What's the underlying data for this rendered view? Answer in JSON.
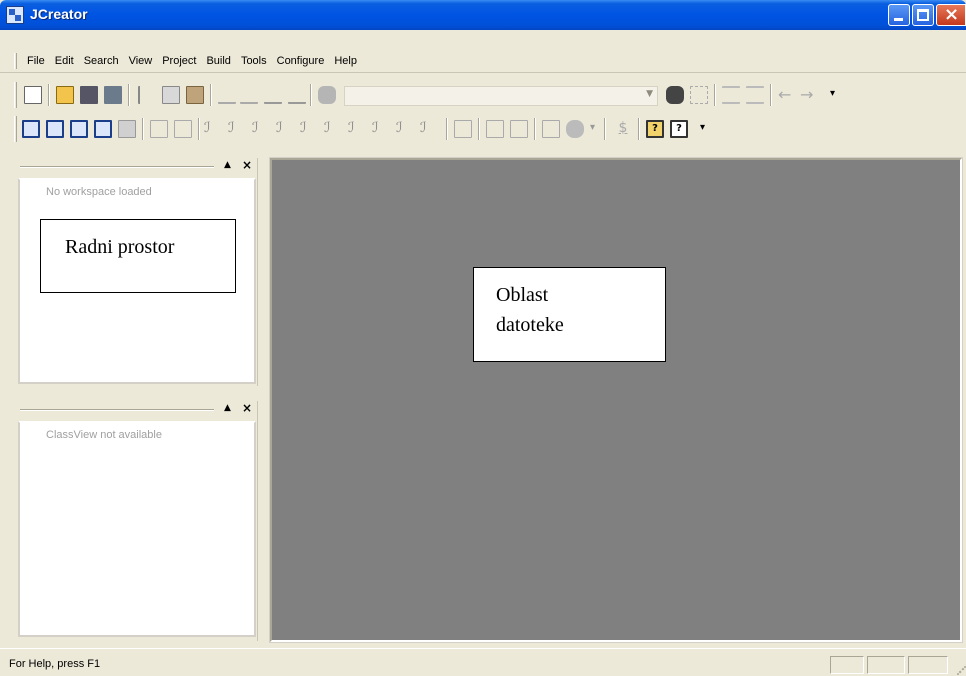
{
  "window": {
    "title": "JCreator"
  },
  "menu": {
    "items": [
      "File",
      "Edit",
      "Search",
      "View",
      "Project",
      "Build",
      "Tools",
      "Configure",
      "Help"
    ]
  },
  "workspace_pane": {
    "message": "No workspace loaded",
    "annotation": "Radni prostor"
  },
  "classview_pane": {
    "message": "ClassView not available"
  },
  "editor": {
    "annotation_line1": "Oblast",
    "annotation_line2": "datoteke"
  },
  "statusbar": {
    "text": "For Help, press F1"
  },
  "colors": {
    "titlebar": "#0054e3",
    "editor_bg": "#808080",
    "chrome": "#ece9d8"
  },
  "toolbar1_icons": [
    "new-file-icon",
    "open-folder-icon",
    "save-icon",
    "save-all-icon",
    "cut-icon",
    "copy-icon",
    "paste-icon",
    "undo-icon",
    "redo-icon",
    "toggle-bookmark-icon",
    "clear-bookmarks-icon",
    "find-icon",
    "find-in-files-icon",
    "replace-icon",
    "indent-icon",
    "outdent-icon",
    "back-icon",
    "forward-icon"
  ],
  "toolbar2_icons": [
    "workspace-toggle-icon",
    "classview-toggle-icon",
    "fileview-toggle-icon",
    "output-toggle-icon",
    "fullscreen-icon",
    "tile-icon",
    "cascade-icon",
    "tool-1-icon",
    "tool-2-icon",
    "tool-3-icon",
    "tool-4-icon",
    "tool-5-icon",
    "tool-6-icon",
    "tool-7-icon",
    "tool-8-icon",
    "tool-9-icon",
    "tool-10-icon",
    "compile-icon",
    "build-icon",
    "run-icon",
    "execute-icon",
    "debug-icon",
    "stop-icon",
    "help-icon",
    "context-help-icon"
  ]
}
